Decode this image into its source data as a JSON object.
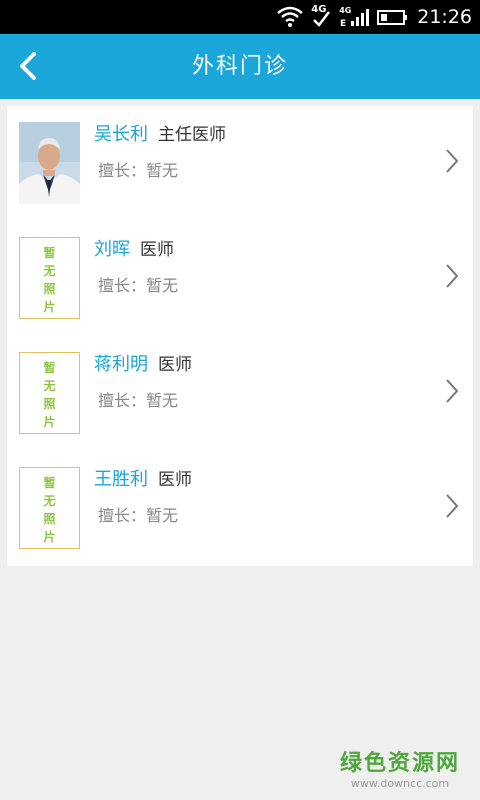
{
  "status_bar": {
    "time": "21:26",
    "network_label_1": "4G",
    "network_label_2": "4G"
  },
  "header": {
    "title": "外科门诊",
    "back_label": "返回"
  },
  "doctors": [
    {
      "name": "吴长利",
      "role": "主任医师",
      "specialty": "擅长：暂无",
      "has_photo": true
    },
    {
      "name": "刘晖",
      "role": "医师",
      "specialty": "擅长：暂无",
      "has_photo": false
    },
    {
      "name": "蒋利明",
      "role": "医师",
      "specialty": "擅长：暂无",
      "has_photo": false
    },
    {
      "name": "王胜利",
      "role": "医师",
      "specialty": "擅长：暂无",
      "has_photo": false
    }
  ],
  "placeholder_text": [
    "暂",
    "无",
    "照",
    "片"
  ],
  "watermark": {
    "main": "绿色资源网",
    "url": "www.downcc.com"
  },
  "colors": {
    "header": "#1ba6d9",
    "name": "#1ba6d9",
    "placeholder_border": "#e6c15a",
    "placeholder_text": "#8cc63f"
  }
}
